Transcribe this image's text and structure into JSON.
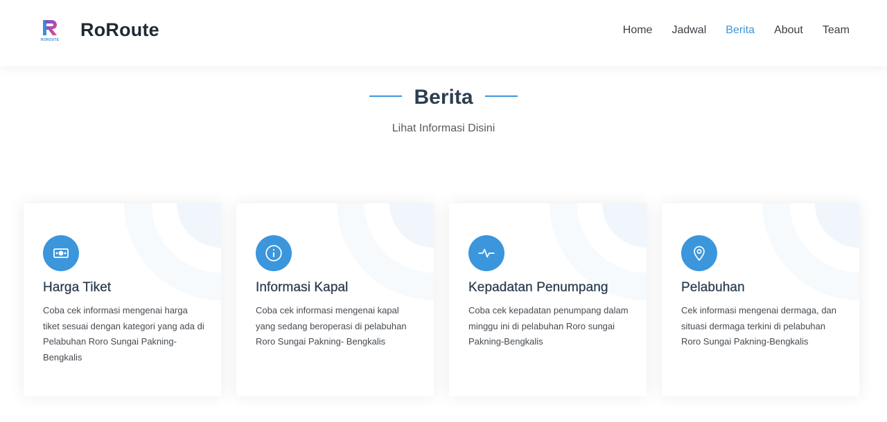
{
  "brand": {
    "name": "RoRoute",
    "logo_caption": "ROROUTE",
    "logo_icon": "roroute-logo-icon"
  },
  "nav": {
    "items": [
      {
        "label": "Home",
        "active": false
      },
      {
        "label": "Jadwal",
        "active": false
      },
      {
        "label": "Berita",
        "active": true
      },
      {
        "label": "About",
        "active": false
      },
      {
        "label": "Team",
        "active": false
      }
    ]
  },
  "section": {
    "title": "Berita",
    "subtitle": "Lihat Informasi Disini"
  },
  "cards": [
    {
      "icon": "money-icon",
      "title": "Harga Tiket",
      "description": "Coba cek informasi mengenai harga tiket sesuai dengan kategori yang ada di Pelabuhan Roro Sungai Pakning-Bengkalis"
    },
    {
      "icon": "info-icon",
      "title": "Informasi Kapal",
      "description": "Coba cek informasi mengenai kapal yang sedang beroperasi di pelabuhan Roro Sungai Pakning- Bengkalis"
    },
    {
      "icon": "activity-icon",
      "title": "Kepadatan Penumpang",
      "description": "Coba cek kepadatan penumpang dalam minggu ini di pelabuhan Roro sungai Pakning-Bengkalis"
    },
    {
      "icon": "location-pin-icon",
      "title": "Pelabuhan",
      "description": "Cek informasi mengenai dermaga, dan situasi dermaga terkini di pelabuhan Roro Sungai Pakning-Bengkalis"
    }
  ],
  "colors": {
    "accent": "#3b96dc",
    "heading": "#2c3e50",
    "text": "#444a50"
  }
}
